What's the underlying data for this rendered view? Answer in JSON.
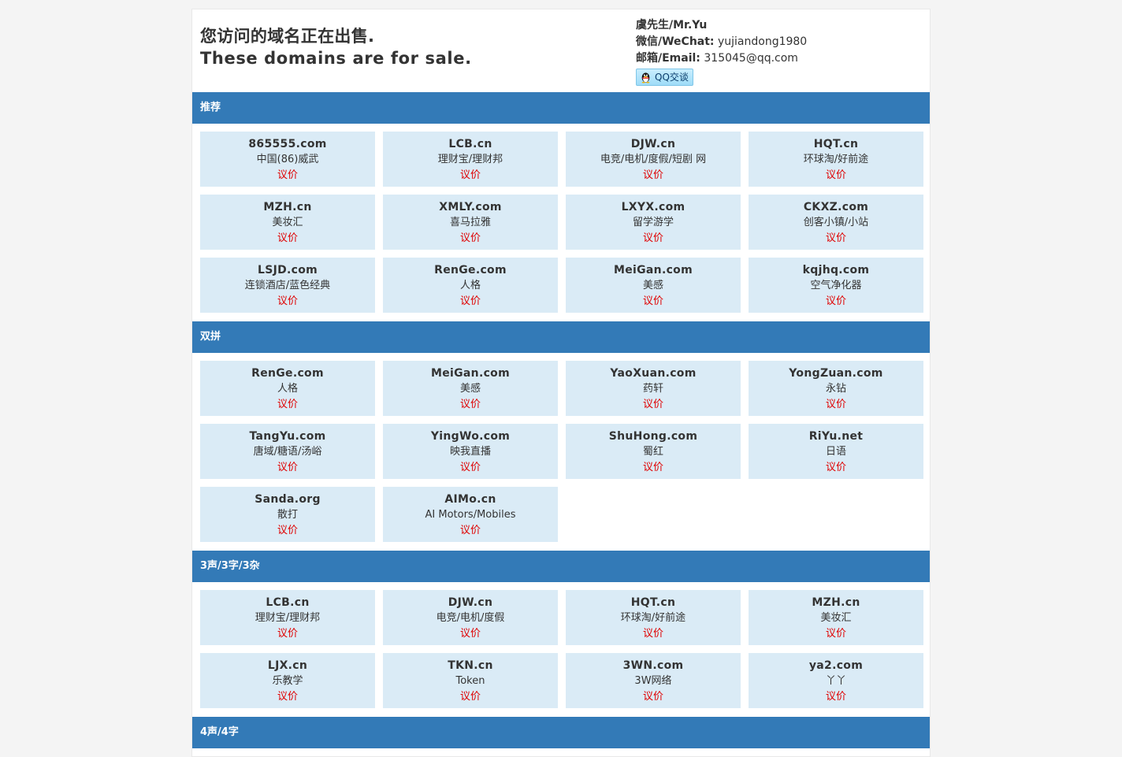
{
  "header": {
    "title_cn": "您访问的域名正在出售.",
    "title_en": "These domains are for sale.",
    "contact_name": "虞先生/Mr.Yu",
    "wechat_label": "微信/WeChat:",
    "wechat_value": "yujiandong1980",
    "email_label": "邮箱/Email:",
    "email_value": "315045@qq.com",
    "qq_button": "QQ交谈"
  },
  "sections": [
    {
      "title": "推荐",
      "items": [
        {
          "domain": "865555.com",
          "desc": "中国(86)威武",
          "price": "议价"
        },
        {
          "domain": "LCB.cn",
          "desc": "理财宝/理财邦",
          "price": "议价"
        },
        {
          "domain": "DJW.cn",
          "desc": "电竞/电机/度假/短剧 网",
          "price": "议价"
        },
        {
          "domain": "HQT.cn",
          "desc": "环球淘/好前途",
          "price": "议价"
        },
        {
          "domain": "MZH.cn",
          "desc": "美妆汇",
          "price": "议价"
        },
        {
          "domain": "XMLY.com",
          "desc": "喜马拉雅",
          "price": "议价"
        },
        {
          "domain": "LXYX.com",
          "desc": "留学游学",
          "price": "议价"
        },
        {
          "domain": "CKXZ.com",
          "desc": "创客小镇/小站",
          "price": "议价"
        },
        {
          "domain": "LSJD.com",
          "desc": "连锁酒店/蓝色经典",
          "price": "议价"
        },
        {
          "domain": "RenGe.com",
          "desc": "人格",
          "price": "议价"
        },
        {
          "domain": "MeiGan.com",
          "desc": "美感",
          "price": "议价"
        },
        {
          "domain": "kqjhq.com",
          "desc": "空气净化器",
          "price": "议价"
        }
      ]
    },
    {
      "title": "双拼",
      "items": [
        {
          "domain": "RenGe.com",
          "desc": "人格",
          "price": "议价"
        },
        {
          "domain": "MeiGan.com",
          "desc": "美感",
          "price": "议价"
        },
        {
          "domain": "YaoXuan.com",
          "desc": "药轩",
          "price": "议价"
        },
        {
          "domain": "YongZuan.com",
          "desc": "永钻",
          "price": "议价"
        },
        {
          "domain": "TangYu.com",
          "desc": "唐域/糖语/汤峪",
          "price": "议价"
        },
        {
          "domain": "YingWo.com",
          "desc": "映我直播",
          "price": "议价"
        },
        {
          "domain": "ShuHong.com",
          "desc": "蜀红",
          "price": "议价"
        },
        {
          "domain": "RiYu.net",
          "desc": "日语",
          "price": "议价"
        },
        {
          "domain": "Sanda.org",
          "desc": "散打",
          "price": "议价"
        },
        {
          "domain": "AIMo.cn",
          "desc": "AI Motors/Mobiles",
          "price": "议价"
        }
      ]
    },
    {
      "title": "3声/3字/3杂",
      "items": [
        {
          "domain": "LCB.cn",
          "desc": "理财宝/理财邦",
          "price": "议价"
        },
        {
          "domain": "DJW.cn",
          "desc": "电竞/电机/度假",
          "price": "议价"
        },
        {
          "domain": "HQT.cn",
          "desc": "环球淘/好前途",
          "price": "议价"
        },
        {
          "domain": "MZH.cn",
          "desc": "美妆汇",
          "price": "议价"
        },
        {
          "domain": "LJX.cn",
          "desc": "乐教学",
          "price": "议价"
        },
        {
          "domain": "TKN.cn",
          "desc": "Token",
          "price": "议价"
        },
        {
          "domain": "3WN.com",
          "desc": "3W网络",
          "price": "议价"
        },
        {
          "domain": "ya2.com",
          "desc": "丫丫",
          "price": "议价"
        }
      ]
    },
    {
      "title": "4声/4字",
      "items": []
    }
  ]
}
